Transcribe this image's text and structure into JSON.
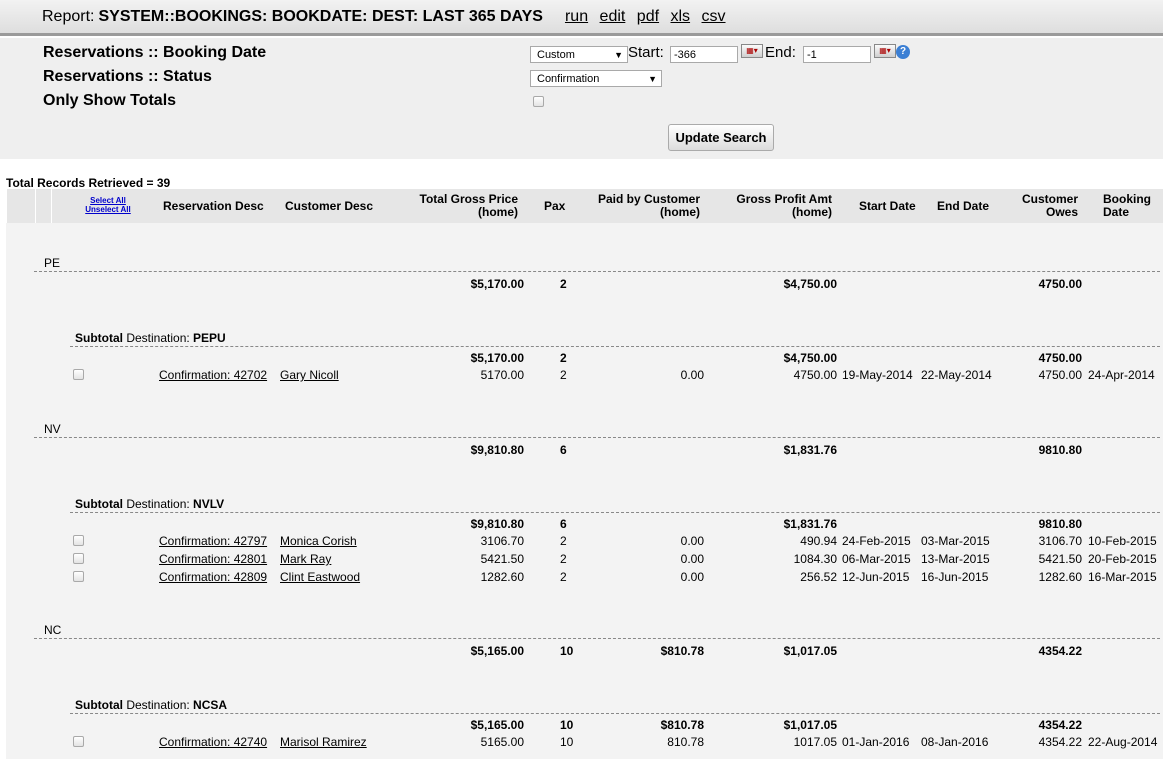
{
  "report": {
    "prefix": "Report:",
    "title": "SYSTEM::BOOKINGS: BOOKDATE: DEST: LAST 365 DAYS",
    "links": [
      "run",
      "edit",
      "pdf",
      "xls",
      "csv"
    ]
  },
  "search": {
    "booking_date_label": "Reservations :: Booking Date",
    "status_label": "Reservations :: Status",
    "totals_label": "Only Show Totals",
    "range_select": "Custom",
    "start_label": "Start:",
    "start_value": "-366",
    "end_label": "End:",
    "end_value": "-1",
    "status_select": "Confirmation",
    "only_show_totals_checked": false,
    "update_button": "Update Search"
  },
  "records_text": "Total Records Retrieved = 39",
  "table": {
    "select_all": "Select All",
    "unselect_all": "Unselect All",
    "headers": {
      "res_desc": "Reservation Desc",
      "cust_desc": "Customer Desc",
      "gross_price": "Total Gross Price",
      "gross_price_2": "(home)",
      "pax": "Pax",
      "paid": "Paid by Customer",
      "paid_2": "(home)",
      "profit": "Gross Profit Amt",
      "profit_2": "(home)",
      "start": "Start Date",
      "end": "End Date",
      "owes": "Customer",
      "owes_2": "Owes",
      "booking": "Booking",
      "booking_2": "Date"
    },
    "subtotal_label": "Subtotal",
    "destination_label": "Destination:",
    "groups": [
      {
        "code": "PE",
        "totals": {
          "gross": "$5,170.00",
          "pax": "2",
          "paid": "",
          "profit": "$4,750.00",
          "owes": "4750.00"
        },
        "subtotal": {
          "dest": "PEPU",
          "gross": "$5,170.00",
          "pax": "2",
          "paid": "",
          "profit": "$4,750.00",
          "owes": "4750.00"
        },
        "rows": [
          {
            "res": "Confirmation: 42702",
            "cust": "Gary Nicoll",
            "gross": "5170.00",
            "pax": "2",
            "paid": "0.00",
            "profit": "4750.00",
            "start": "19-May-2014",
            "end": "22-May-2014",
            "owes": "4750.00",
            "booked": "24-Apr-2014"
          }
        ]
      },
      {
        "code": "NV",
        "totals": {
          "gross": "$9,810.80",
          "pax": "6",
          "paid": "",
          "profit": "$1,831.76",
          "owes": "9810.80"
        },
        "subtotal": {
          "dest": "NVLV",
          "gross": "$9,810.80",
          "pax": "6",
          "paid": "",
          "profit": "$1,831.76",
          "owes": "9810.80"
        },
        "rows": [
          {
            "res": "Confirmation: 42797",
            "cust": "Monica Corish",
            "gross": "3106.70",
            "pax": "2",
            "paid": "0.00",
            "profit": "490.94",
            "start": "24-Feb-2015",
            "end": "03-Mar-2015",
            "owes": "3106.70",
            "booked": "10-Feb-2015"
          },
          {
            "res": "Confirmation: 42801",
            "cust": "Mark Ray",
            "gross": "5421.50",
            "pax": "2",
            "paid": "0.00",
            "profit": "1084.30",
            "start": "06-Mar-2015",
            "end": "13-Mar-2015",
            "owes": "5421.50",
            "booked": "20-Feb-2015"
          },
          {
            "res": "Confirmation: 42809",
            "cust": "Clint Eastwood",
            "gross": "1282.60",
            "pax": "2",
            "paid": "0.00",
            "profit": "256.52",
            "start": "12-Jun-2015",
            "end": "16-Jun-2015",
            "owes": "1282.60",
            "booked": "16-Mar-2015"
          }
        ]
      },
      {
        "code": "NC",
        "totals": {
          "gross": "$5,165.00",
          "pax": "10",
          "paid": "$810.78",
          "profit": "$1,017.05",
          "owes": "4354.22"
        },
        "subtotal": {
          "dest": "NCSA",
          "gross": "$5,165.00",
          "pax": "10",
          "paid": "$810.78",
          "profit": "$1,017.05",
          "owes": "4354.22"
        },
        "rows": [
          {
            "res": "Confirmation: 42740",
            "cust": "Marisol Ramirez",
            "gross": "5165.00",
            "pax": "10",
            "paid": "810.78",
            "profit": "1017.05",
            "start": "01-Jan-2016",
            "end": "08-Jan-2016",
            "owes": "4354.22",
            "booked": "22-Aug-2014"
          }
        ]
      }
    ]
  },
  "icons": {
    "calendar": "calendar-icon",
    "help": "help-icon",
    "dropdown": "chevron-down-icon"
  }
}
